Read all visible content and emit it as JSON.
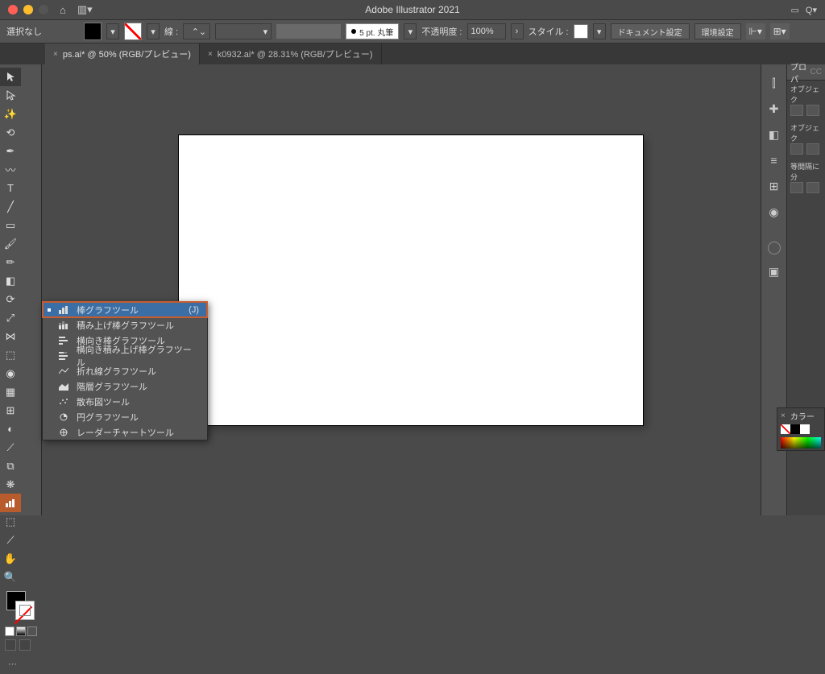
{
  "app_title": "Adobe Illustrator 2021",
  "selection_status": "選択なし",
  "control": {
    "stroke_label": "線 :",
    "pt_label": "5 pt. 丸筆",
    "opacity_label": "不透明度 :",
    "opacity_value": "100%",
    "style_label": "スタイル :",
    "doc_setup": "ドキュメント設定",
    "prefs": "環境設定"
  },
  "tabs": [
    {
      "label": "ps.ai* @ 50% (RGB/プレビュー)"
    },
    {
      "label": "k0932.ai* @ 28.31% (RGB/プレビュー)"
    }
  ],
  "graph_flyout": [
    {
      "label": "棒グラフツール",
      "shortcut": "(J)",
      "selected": true
    },
    {
      "label": "積み上げ棒グラフツール"
    },
    {
      "label": "横向き棒グラフツール"
    },
    {
      "label": "横向き積み上げ棒グラフツール"
    },
    {
      "label": "折れ線グラフツール"
    },
    {
      "label": "階層グラフツール"
    },
    {
      "label": "散布図ツール"
    },
    {
      "label": "円グラフツール"
    },
    {
      "label": "レーダーチャートツール"
    }
  ],
  "rpanel": {
    "tab1": "プロパ",
    "tab1b": "CC",
    "sec1": "オブジェク",
    "sec2": "オブジェク",
    "sec3": "等間隔に分",
    "color_tab": "カラー"
  }
}
